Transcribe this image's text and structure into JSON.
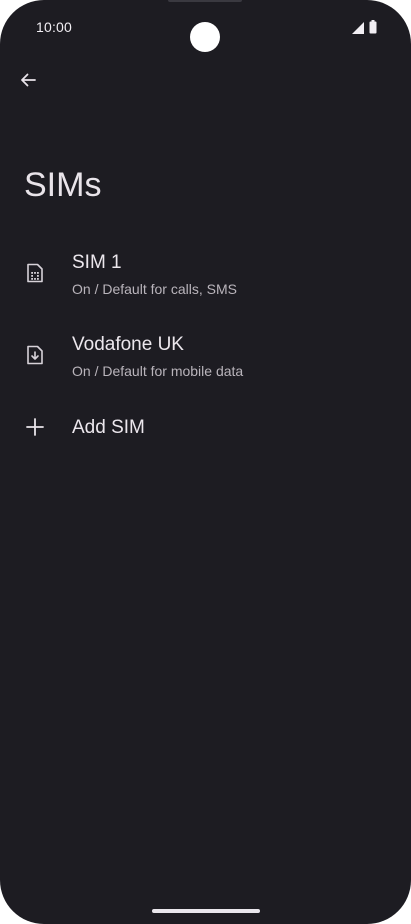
{
  "status_bar": {
    "time": "10:00",
    "icons": [
      "signal-icon",
      "battery-icon"
    ]
  },
  "header": {
    "back_icon": "arrow-back-icon",
    "title": "SIMs"
  },
  "sims": [
    {
      "icon": "sim-card-icon",
      "name": "SIM 1",
      "status": "On / Default for calls, SMS"
    },
    {
      "icon": "esim-download-icon",
      "name": "Vodafone UK",
      "status": "On / Default for mobile data"
    }
  ],
  "add_sim": {
    "icon": "plus-icon",
    "label": "Add SIM"
  },
  "colors": {
    "background": "#1d1c22",
    "text_primary": "#ece7ed",
    "text_secondary": "#b9b4bb"
  }
}
